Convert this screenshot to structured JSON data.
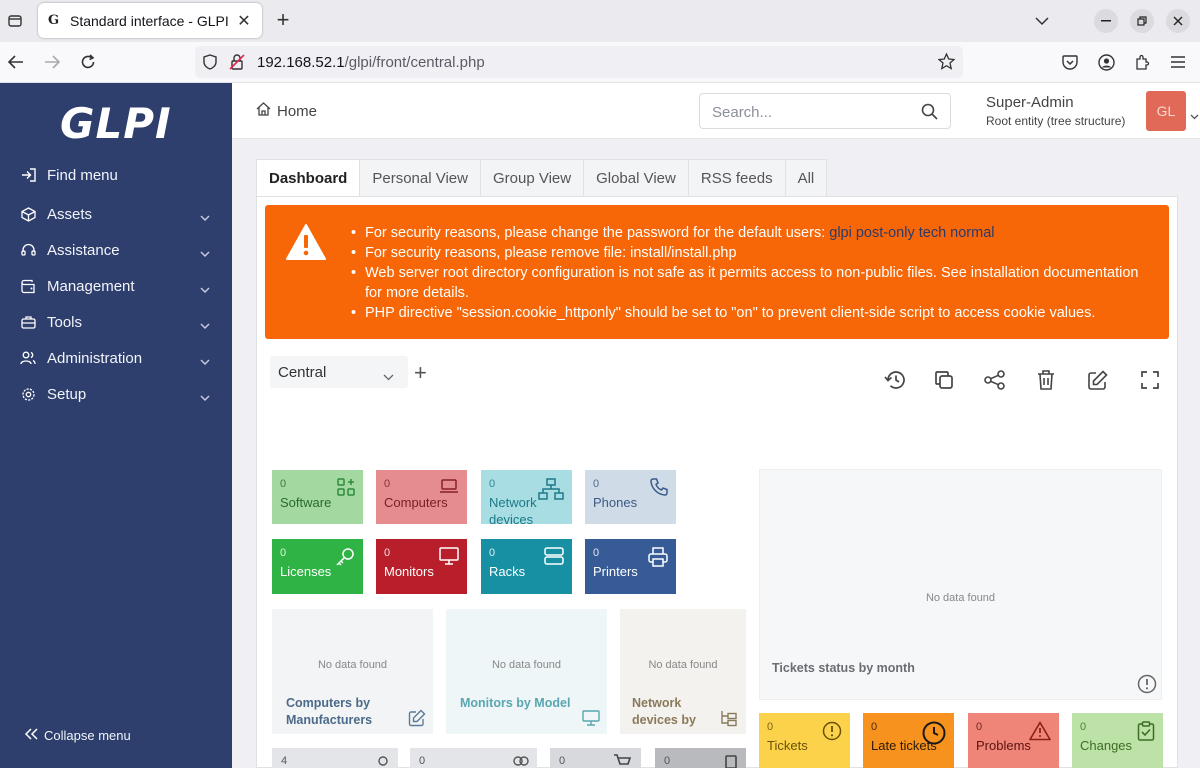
{
  "browser": {
    "tab_title": "Standard interface - GLPI",
    "tab_favicon": "G",
    "url_host": "192.168.52.1",
    "url_path": "/glpi/front/central.php"
  },
  "sidebar": {
    "logo": "GLPI",
    "items": [
      {
        "label": "Find menu",
        "icon": "arrow-right-to-bracket-icon"
      },
      {
        "label": "Assets",
        "icon": "box-icon"
      },
      {
        "label": "Assistance",
        "icon": "headset-icon"
      },
      {
        "label": "Management",
        "icon": "wallet-icon"
      },
      {
        "label": "Tools",
        "icon": "briefcase-icon"
      },
      {
        "label": "Administration",
        "icon": "users-icon"
      },
      {
        "label": "Setup",
        "icon": "gear-icon"
      }
    ],
    "collapse_label": "Collapse menu"
  },
  "header": {
    "breadcrumb": "Home",
    "search_placeholder": "Search...",
    "user_name": "Super-Admin",
    "user_entity": "Root entity (tree structure)",
    "avatar_initials": "GL"
  },
  "tabs": [
    "Dashboard",
    "Personal View",
    "Group View",
    "Global View",
    "RSS feeds",
    "All"
  ],
  "alert": {
    "lines": [
      "For security reasons, please change the password for the default users:",
      "For security reasons, please remove file: install/install.php",
      "Web server root directory configuration is not safe as it permits access to non-public files. See installation documentation for more details.",
      "PHP directive \"session.cookie_httponly\" should be set to \"on\" to prevent client-side script to access cookie values."
    ],
    "default_users": "glpi post-only tech normal",
    "color": "#f76707"
  },
  "dashboard": {
    "selected": "Central",
    "cards": [
      {
        "count": "0",
        "label": "Software",
        "color": "#a3d9a0"
      },
      {
        "count": "0",
        "label": "Computers",
        "color": "#e48c8e"
      },
      {
        "count": "0",
        "label": "Network devices",
        "color": "#a7dde3"
      },
      {
        "count": "0",
        "label": "Phones",
        "color": "#cfdbe6"
      },
      {
        "count": "0",
        "label": "Licenses",
        "color": "#2fb344"
      },
      {
        "count": "0",
        "label": "Monitors",
        "color": "#b91f2b"
      },
      {
        "count": "0",
        "label": "Racks",
        "color": "#1690a2"
      },
      {
        "count": "0",
        "label": "Printers",
        "color": "#375b96"
      }
    ],
    "widgets": [
      {
        "title": "Computers by Manufacturers",
        "no_data": "No data found"
      },
      {
        "title": "Monitors by Model",
        "no_data": "No data found"
      },
      {
        "title": "Network devices by",
        "no_data": "No data found"
      },
      {
        "title": "Tickets status by month",
        "no_data": "No data found"
      }
    ],
    "ticket_cards": [
      {
        "count": "0",
        "label": "Tickets",
        "color": "#fbd24a"
      },
      {
        "count": "0",
        "label": "Late tickets",
        "color": "#f7921e"
      },
      {
        "count": "0",
        "label": "Problems",
        "color": "#ef8578"
      },
      {
        "count": "0",
        "label": "Changes",
        "color": "#bde2a8"
      }
    ],
    "bottom_tiles": [
      "4",
      "0",
      "0",
      "0"
    ]
  }
}
